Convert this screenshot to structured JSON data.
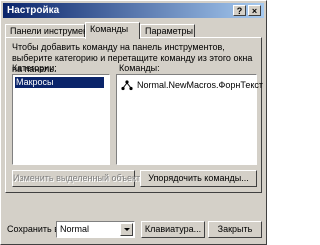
{
  "window": {
    "title": "Настройка"
  },
  "titlebar_buttons": {
    "help": "?",
    "close": "×"
  },
  "tabs": [
    {
      "label": "Панели инструментов"
    },
    {
      "label": "Команды",
      "active": true
    },
    {
      "label": "Параметры"
    }
  ],
  "panel": {
    "description": "Чтобы добавить команду на панель инструментов, выберите категорию и перетащите команду из этого окна на панель.",
    "categories_label": "Категории:",
    "commands_label": "Команды:",
    "categories": [
      "Макросы"
    ],
    "commands": [
      {
        "label": "Normal.NewMacros.ФорнТекст",
        "icon": "macro-icon"
      }
    ],
    "modify_selection_button": "Изменить выделенный объект",
    "rearrange_commands_button": "Упорядочить команды..."
  },
  "footer": {
    "save_in_label": "Сохранить в:",
    "save_in_value": "Normal",
    "keyboard_button": "Клавиатура...",
    "close_button": "Закрыть"
  }
}
